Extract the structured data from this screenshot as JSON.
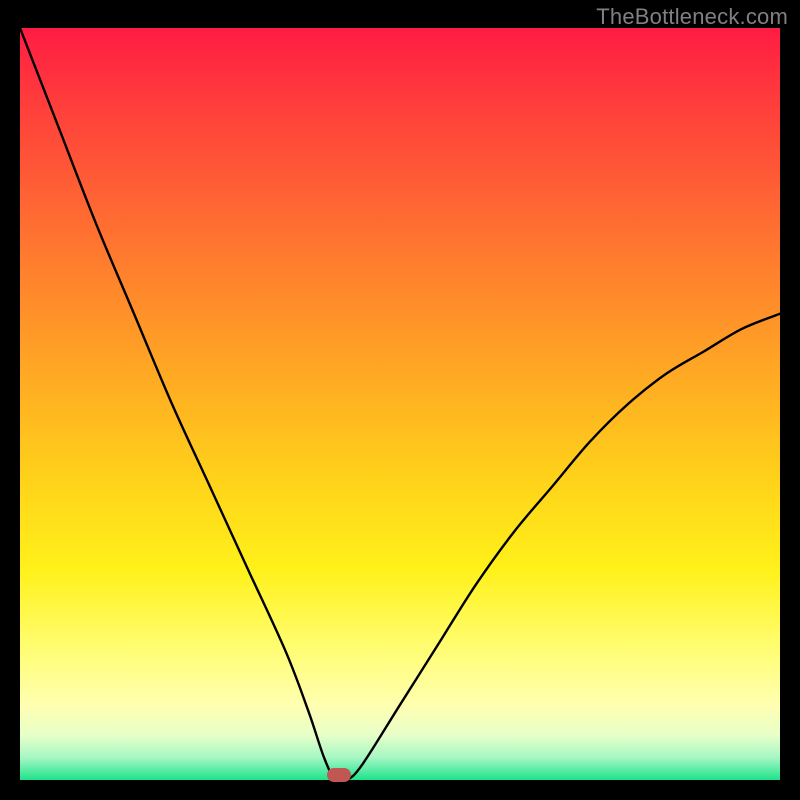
{
  "watermark": "TheBottleneck.com",
  "chart_data": {
    "type": "line",
    "title": "",
    "xlabel": "",
    "ylabel": "",
    "xlim": [
      0,
      100
    ],
    "ylim": [
      0,
      100
    ],
    "grid": false,
    "series": [
      {
        "name": "curve",
        "x": [
          0,
          5,
          10,
          15,
          20,
          25,
          30,
          35,
          38,
          40,
          41.5,
          43,
          45,
          50,
          55,
          60,
          65,
          70,
          75,
          80,
          85,
          90,
          95,
          100
        ],
        "y": [
          100,
          87,
          74,
          62,
          50,
          39,
          28,
          17,
          9,
          3,
          0,
          0,
          2,
          10,
          18,
          26,
          33,
          39,
          45,
          50,
          54,
          57,
          60,
          62
        ]
      }
    ],
    "marker": {
      "x": 42,
      "y": 0.7
    },
    "background": "rainbow-vertical-gradient"
  }
}
